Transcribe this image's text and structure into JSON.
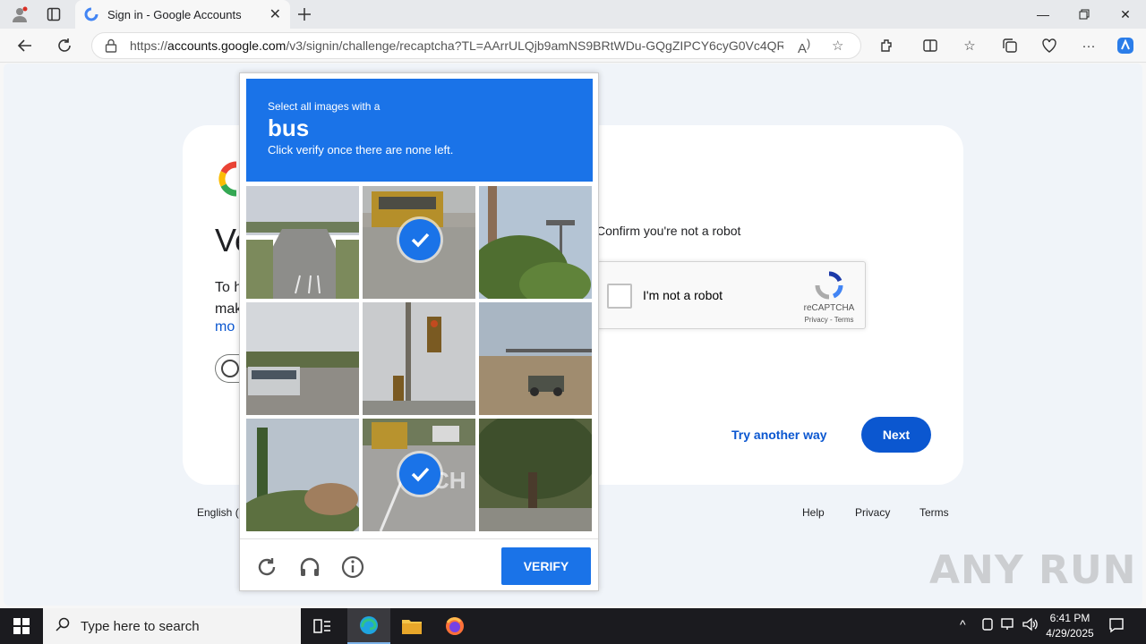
{
  "browser": {
    "tab_title": "Sign in - Google Accounts",
    "url_prefix": "https://",
    "url_host": "accounts.google.com",
    "url_path": "/v3/signin/challenge/recaptcha?TL=AArrULQjb9amNS9BRtWDu-GQgZIPCY6cyG0Vc4QR..."
  },
  "signin": {
    "heading": "Ve",
    "body_line1": "To h",
    "body_line2": "mak",
    "more_link": "mo",
    "confirm_text": "Confirm you're not a robot",
    "not_robot_label": "I'm not a robot",
    "recaptcha_brand": "reCAPTCHA",
    "recaptcha_terms": "Privacy - Terms",
    "try_another": "Try another way",
    "next": "Next",
    "language": "English (",
    "footer": {
      "help": "Help",
      "privacy": "Privacy",
      "terms": "Terms"
    }
  },
  "challenge": {
    "instruction_small": "Select all images with a",
    "target_word": "bus",
    "instruction_sub": "Click verify once there are none left.",
    "tiles": [
      {
        "content": "highway",
        "selected": false
      },
      {
        "content": "school bus",
        "selected": true
      },
      {
        "content": "tree and pole",
        "selected": false
      },
      {
        "content": "bus on highway",
        "selected": false
      },
      {
        "content": "traffic light",
        "selected": false
      },
      {
        "content": "intersection",
        "selected": false
      },
      {
        "content": "trees",
        "selected": false
      },
      {
        "content": "school bus street",
        "selected": true
      },
      {
        "content": "tree",
        "selected": false
      }
    ],
    "verify": "VERIFY",
    "tile_overlay_text": "CH"
  },
  "watermark": "ANY RUN",
  "taskbar": {
    "search_placeholder": "Type here to search",
    "time": "6:41 PM",
    "date": "4/29/2025"
  },
  "colors": {
    "accent": "#1a73e8",
    "google_blue": "#0b57d0"
  }
}
